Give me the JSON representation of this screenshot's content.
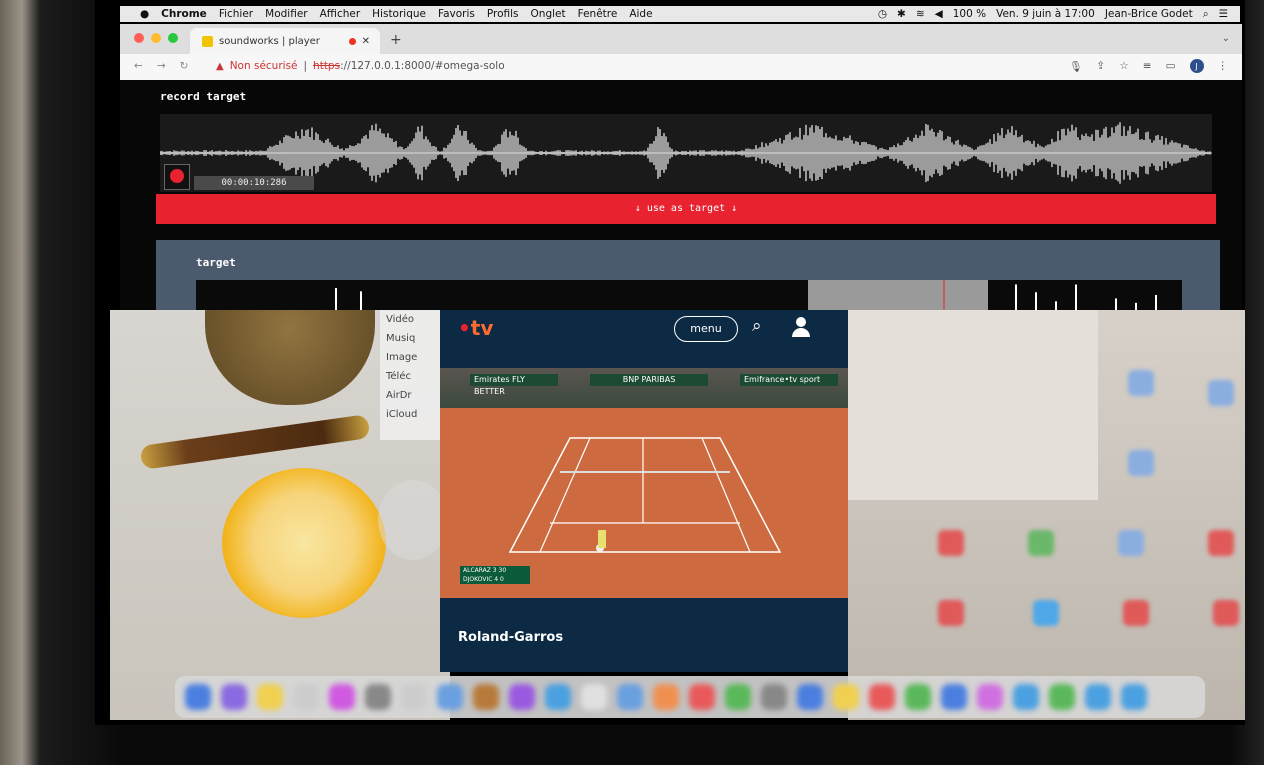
{
  "menubar": {
    "app": "Chrome",
    "items": [
      "Fichier",
      "Modifier",
      "Afficher",
      "Historique",
      "Favoris",
      "Profils",
      "Onglet",
      "Fenêtre",
      "Aide"
    ],
    "battery": "100 %",
    "datetime": "Ven. 9 juin à 17:00",
    "user": "Jean-Brice Godet"
  },
  "browser": {
    "tab_title": "soundworks | player",
    "security_label": "Non sécurisé",
    "url_scheme": "https",
    "url_rest": "://127.0.0.1:8000/#omega-solo",
    "profile_initial": "J"
  },
  "app": {
    "record_title": "record target",
    "timecode": "00:00:10:286",
    "use_button": "↓ use as target ↓",
    "target_title": "target"
  },
  "finder": {
    "items": [
      "Vidéo",
      "Musiq",
      "Image",
      "Téléc",
      "AirDr",
      "iCloud"
    ]
  },
  "tv": {
    "menu_label": "menu",
    "title": "Roland-Garros",
    "banner_left": "Emirates FLY BETTER",
    "banner_mid": "BNP PARIBAS",
    "banner_right": "Emifrance•tv sport",
    "score_p1": "ALCARAZ 3 30",
    "score_p2": "DJOKOVIC 4 0"
  }
}
